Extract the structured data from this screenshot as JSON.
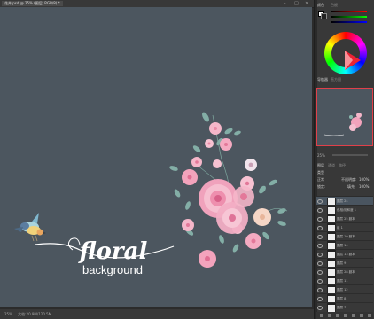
{
  "document": {
    "tab_title": "花卉.psd @ 25% (图层, RGB/8) *",
    "status_zoom": "25%",
    "status_doc": "文档:20.9M/120.5M"
  },
  "canvas": {
    "background_color": "#4c565f",
    "title_script": "floral",
    "subtitle": "background"
  },
  "color_panel": {
    "tabs": [
      "颜色",
      "色板"
    ],
    "foreground": "#ffffff",
    "background": "#222222"
  },
  "navigator_panel": {
    "tabs": [
      "导航器",
      "直方图"
    ],
    "zoom": "25%"
  },
  "layers_panel": {
    "tabs": [
      "图层",
      "通道",
      "路径"
    ],
    "kind_label": "类型",
    "blend_mode": "正常",
    "opacity_label": "不透明度:",
    "opacity": "100%",
    "lock_label": "锁定:",
    "fill_label": "填充:",
    "fill": "100%",
    "layers": [
      "图层 24",
      "色相/饱和度 1",
      "图层 25 副本",
      "组 1",
      "图层 10 副本",
      "图层 14",
      "图层 13 副本",
      "图层 9",
      "图层 28 副本",
      "图层 11",
      "图层 12",
      "图层 8",
      "图层 7"
    ]
  }
}
